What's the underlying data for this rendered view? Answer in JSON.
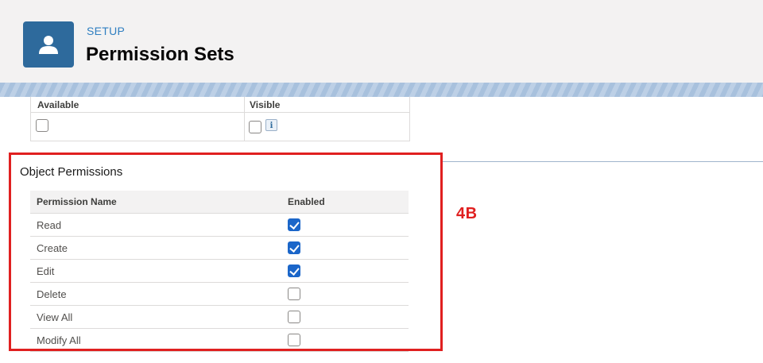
{
  "header": {
    "icon": "user-icon",
    "setup_label": "SETUP",
    "title": "Permission Sets"
  },
  "field_access": {
    "columns": [
      "Available",
      "Visible"
    ],
    "available_checked": false,
    "visible_checked": false,
    "info_icon": "info-icon",
    "info_glyph": "i"
  },
  "object_permissions": {
    "title": "Object Permissions",
    "columns": [
      "Permission Name",
      "Enabled"
    ],
    "rows": [
      {
        "name": "Read",
        "enabled": true
      },
      {
        "name": "Create",
        "enabled": true
      },
      {
        "name": "Edit",
        "enabled": true
      },
      {
        "name": "Delete",
        "enabled": false
      },
      {
        "name": "View All",
        "enabled": false
      },
      {
        "name": "Modify All",
        "enabled": false
      }
    ]
  },
  "callout": {
    "label": "4B",
    "color": "#e02020"
  },
  "colors": {
    "accent": "#2e6a9c",
    "setup_text": "#2f7fc1",
    "checkbox_checked": "#1b66c9"
  }
}
